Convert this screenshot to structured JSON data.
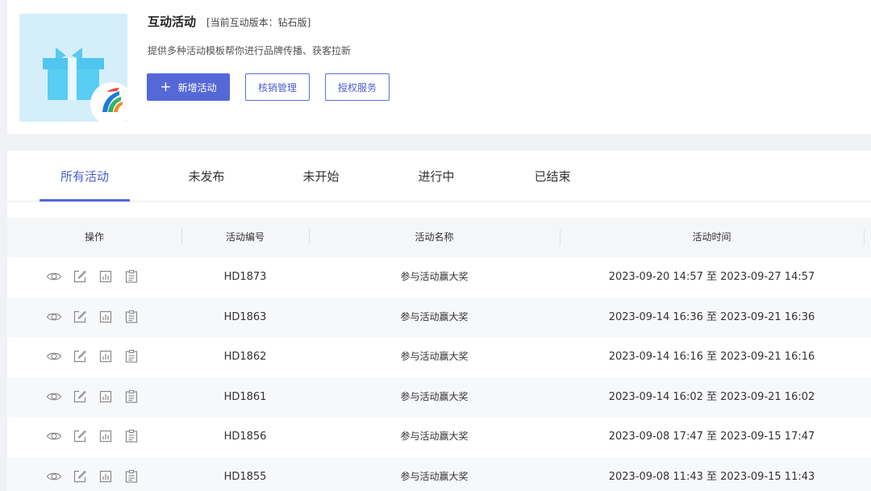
{
  "header": {
    "title": "互动活动",
    "version": "[当前互动版本：钻石版]",
    "description": "提供多种活动模板帮你进行品牌传播、获客拉新",
    "buttons": {
      "new_activity": "新增活动",
      "verify_manage": "核销管理",
      "auth_service": "授权服务"
    }
  },
  "tabs": [
    {
      "label": "所有活动",
      "active": true
    },
    {
      "label": "未发布",
      "active": false
    },
    {
      "label": "未开始",
      "active": false
    },
    {
      "label": "进行中",
      "active": false
    },
    {
      "label": "已结束",
      "active": false
    }
  ],
  "table": {
    "columns": [
      "操作",
      "活动编号",
      "活动名称",
      "活动时间"
    ],
    "row_actions": [
      "eye-icon",
      "edit-icon",
      "chart-icon",
      "clipboard-icon"
    ],
    "rows": [
      {
        "id": "HD1873",
        "name": "参与活动赢大奖",
        "time": "2023-09-20 14:57 至 2023-09-27 14:57"
      },
      {
        "id": "HD1863",
        "name": "参与活动赢大奖",
        "time": "2023-09-14 16:36 至 2023-09-21 16:36"
      },
      {
        "id": "HD1862",
        "name": "参与活动赢大奖",
        "time": "2023-09-14 16:16 至 2023-09-21 16:16"
      },
      {
        "id": "HD1861",
        "name": "参与活动赢大奖",
        "time": "2023-09-14 16:02 至 2023-09-21 16:02"
      },
      {
        "id": "HD1856",
        "name": "参与活动赢大奖",
        "time": "2023-09-08 17:47 至 2023-09-15 17:47"
      },
      {
        "id": "HD1855",
        "name": "参与活动赢大奖",
        "time": "2023-09-08 11:43 至 2023-09-15 11:43"
      }
    ]
  },
  "colors": {
    "accent": "#5468d8",
    "gift_blue": "#4fc6ef",
    "page_bg": "#f0f2f5"
  }
}
